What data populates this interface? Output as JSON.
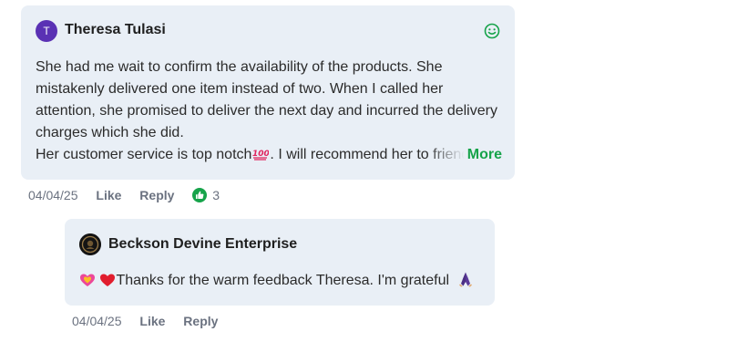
{
  "comment": {
    "avatar_initial": "T",
    "author": "Theresa Tulasi",
    "paragraph1": "She had me wait to confirm the availability of the products. She mistakenly delivered one item instead of two. When I called her attention, she promised to deliver the next day and incurred the delivery charges which she did.",
    "line2_before_emoji": "Her customer service is top notch",
    "line2_after_emoji": ". I  will recommend her to friends",
    "more_label": "More",
    "date": "04/04/25",
    "like_label": "Like",
    "reply_label": "Reply",
    "like_count": "3",
    "icons": {
      "react": "smile-icon",
      "hundred": "hundred-points-icon",
      "like": "thumbs-up-icon"
    }
  },
  "reply": {
    "author": "Beckson Devine Enterprise",
    "text": "Thanks for the warm feedback Theresa.  I'm grateful",
    "date": "04/04/25",
    "like_label": "Like",
    "reply_label": "Reply",
    "icons": {
      "leading": [
        "sparkling-heart-icon",
        "red-heart-icon"
      ],
      "trailing": "praying-hands-icon"
    }
  },
  "colors": {
    "bubble": "#e9eff6",
    "accent_green": "#16a34a",
    "avatar_purple": "#5a31b4",
    "meta_gray": "#6b7280"
  }
}
